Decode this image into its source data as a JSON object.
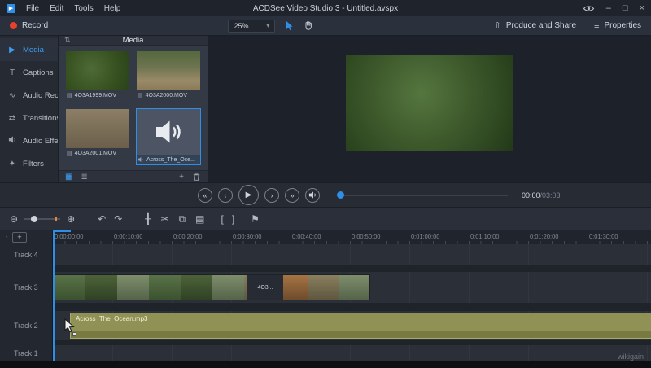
{
  "colors": {
    "accent": "#2F8FE8",
    "record_red": "#E8402A",
    "audio_clip": "#8F9155"
  },
  "titlebar": {
    "title": "ACDSee Video Studio 3 - Untitled.avspx",
    "menus": [
      {
        "label": "File"
      },
      {
        "label": "Edit"
      },
      {
        "label": "Tools"
      },
      {
        "label": "Help"
      }
    ]
  },
  "toolbar": {
    "record_label": "Record",
    "zoom_value": "25%",
    "produce_label": "Produce and Share",
    "properties_label": "Properties"
  },
  "sidebar": {
    "items": [
      {
        "label": "Media",
        "active": true
      },
      {
        "label": "Captions"
      },
      {
        "label": "Audio Reco..."
      },
      {
        "label": "Transitions"
      },
      {
        "label": "Audio Effects"
      },
      {
        "label": "Filters"
      }
    ]
  },
  "media_panel": {
    "tab_label": "Media",
    "items": [
      {
        "name": "4O3A1999.MOV",
        "type": "video"
      },
      {
        "name": "4O3A2000.MOV",
        "type": "video"
      },
      {
        "name": "4O3A2001.MOV",
        "type": "video"
      },
      {
        "name": "Across_The_Oce...",
        "type": "audio",
        "selected": true
      }
    ]
  },
  "player": {
    "time_current": "00:00",
    "time_total": "/03:03"
  },
  "timeline": {
    "ruler_labels": [
      "0:00:00;00",
      "0:00:10;00",
      "0:00:20;00",
      "0:00:30;00",
      "0:00:40;00",
      "0:00:50;00",
      "0:01:00;00",
      "0:01:10;00",
      "0:01:20;00",
      "0:01:30;00"
    ],
    "tracks": [
      {
        "name": "Track 4"
      },
      {
        "name": "Track 3"
      },
      {
        "name": "Track 2"
      },
      {
        "name": "Track 1"
      }
    ],
    "clips": {
      "video_gap_label": "4O3...",
      "audio_label": "Across_The_Ocean.mp3"
    }
  },
  "icons": {
    "app": "▶",
    "minimize": "–",
    "maximize": "□",
    "close": "×",
    "chevron_down": "▾",
    "share": "⇧",
    "menu": "≡",
    "sort": "⇅",
    "media": "▶",
    "captions": "T",
    "audio_record": "∿",
    "transitions": "⇄",
    "filters": "✦",
    "grid_view": "▦",
    "list_view": "≣",
    "add": "+",
    "file_video": "▤",
    "zoom_out": "⊖",
    "zoom_in": "⊕",
    "undo": "↶",
    "redo": "↷",
    "split": "╂",
    "cut": "✂",
    "copy": "⧉",
    "paste": "▤",
    "mark_in": "[",
    "mark_out": "]",
    "marker": "⚑",
    "prev": "«",
    "step_back": "‹",
    "play": "▶",
    "step_forward": "›",
    "next": "»",
    "track_updown": "↕"
  },
  "watermark": "wikigain"
}
